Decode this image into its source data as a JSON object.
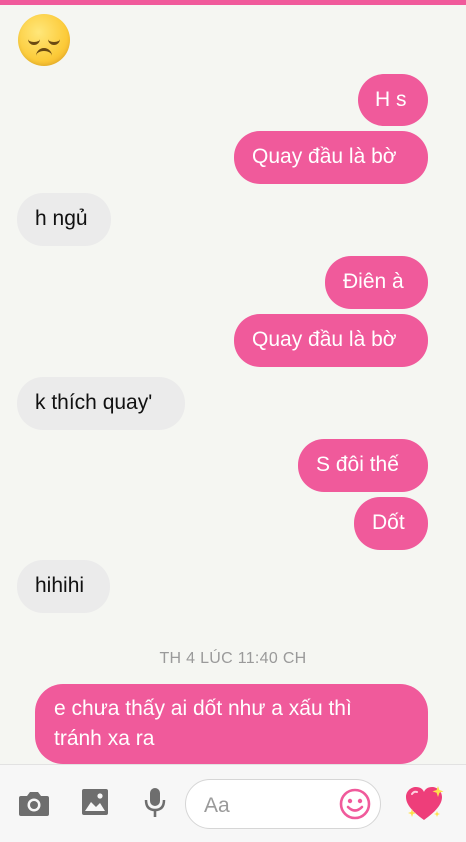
{
  "messages": [
    {
      "side": "out",
      "text": "H s"
    },
    {
      "side": "out",
      "text": "Quay đầu là bờ"
    },
    {
      "side": "in",
      "text": "h ngủ"
    },
    {
      "side": "out",
      "text": "Điên à"
    },
    {
      "side": "out",
      "text": "Quay đầu là bờ"
    },
    {
      "side": "in",
      "text": "k thích quay'"
    },
    {
      "side": "out",
      "text": "S đôi thế"
    },
    {
      "side": "out",
      "text": "Dốt"
    },
    {
      "side": "in",
      "text": "hihihi"
    },
    {
      "side": "out",
      "text_lines": [
        "e chưa thấy ai dốt như a xấu thì",
        "tránh xa ra"
      ]
    }
  ],
  "timestamp": "TH 4 LÚC 11:40 CH",
  "composer": {
    "placeholder": "Aa",
    "icons": [
      "camera-icon",
      "image-icon",
      "microphone-icon",
      "smiley-icon",
      "heart-sparkle-icon"
    ]
  },
  "colors": {
    "accent": "#f05a9b",
    "incoming_bubble": "#ebebeb",
    "background": "#f5f6f2",
    "icon_gray": "#6e6e6e"
  }
}
